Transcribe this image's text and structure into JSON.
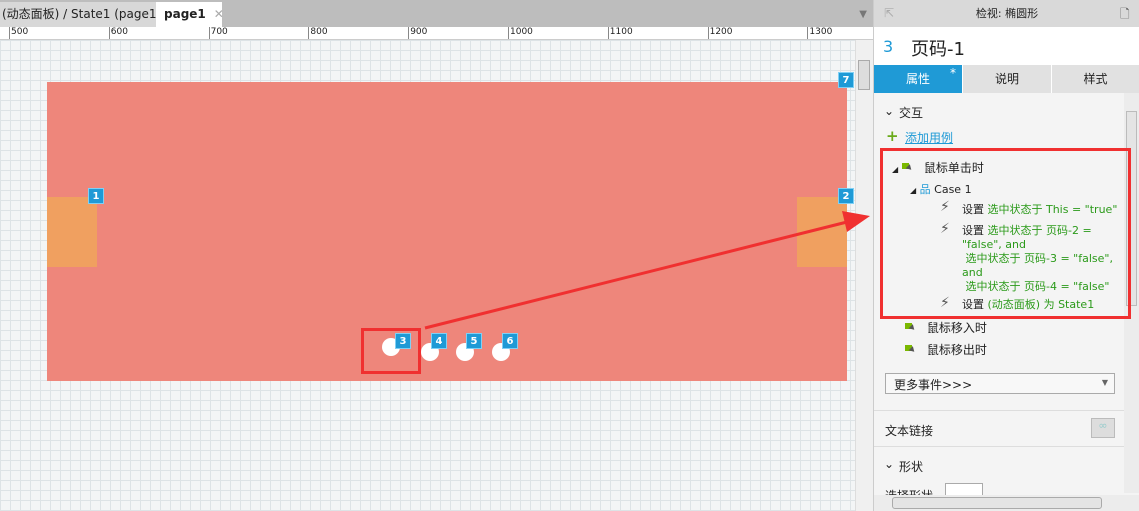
{
  "tabs": [
    {
      "label": "(动态面板) / State1 (page1)",
      "active": false
    },
    {
      "label": "page1",
      "active": true
    }
  ],
  "ruler": [
    "500",
    "600",
    "700",
    "800",
    "900",
    "1000",
    "1100",
    "1200",
    "1300"
  ],
  "canvas": {
    "panel_color": "#ee867b",
    "side_color": "#f0a060",
    "markers": [
      "1",
      "2",
      "3",
      "4",
      "5",
      "6",
      "7"
    ]
  },
  "inspector": {
    "header": "检视: 椭圆形",
    "number": "3",
    "name": "页码-1",
    "tabs": [
      "属性",
      "说明",
      "样式"
    ],
    "tab_modified": "*",
    "section_interaction": "交互",
    "add_case": "添加用例",
    "event_click": "鼠标单击时",
    "case": "Case 1",
    "actions": [
      {
        "verb": "设置",
        "text": "选中状态于 This = \"true\""
      },
      {
        "verb": "设置",
        "text": "选中状态于 页码-2 = \"false\", and\n 选中状态于 页码-3 = \"false\", and\n 选中状态于 页码-4 = \"false\""
      },
      {
        "verb": "设置",
        "text": "(动态面板) 为 State1"
      }
    ],
    "event_enter": "鼠标移入时",
    "event_leave": "鼠标移出时",
    "more_events": "更多事件>>>",
    "text_link": "文本链接",
    "section_shape": "形状",
    "select_shape": "选择形状"
  },
  "colors": {
    "accent": "#1f9ad6",
    "highlight": "#f03030",
    "action_green": "#2b9a1a"
  }
}
